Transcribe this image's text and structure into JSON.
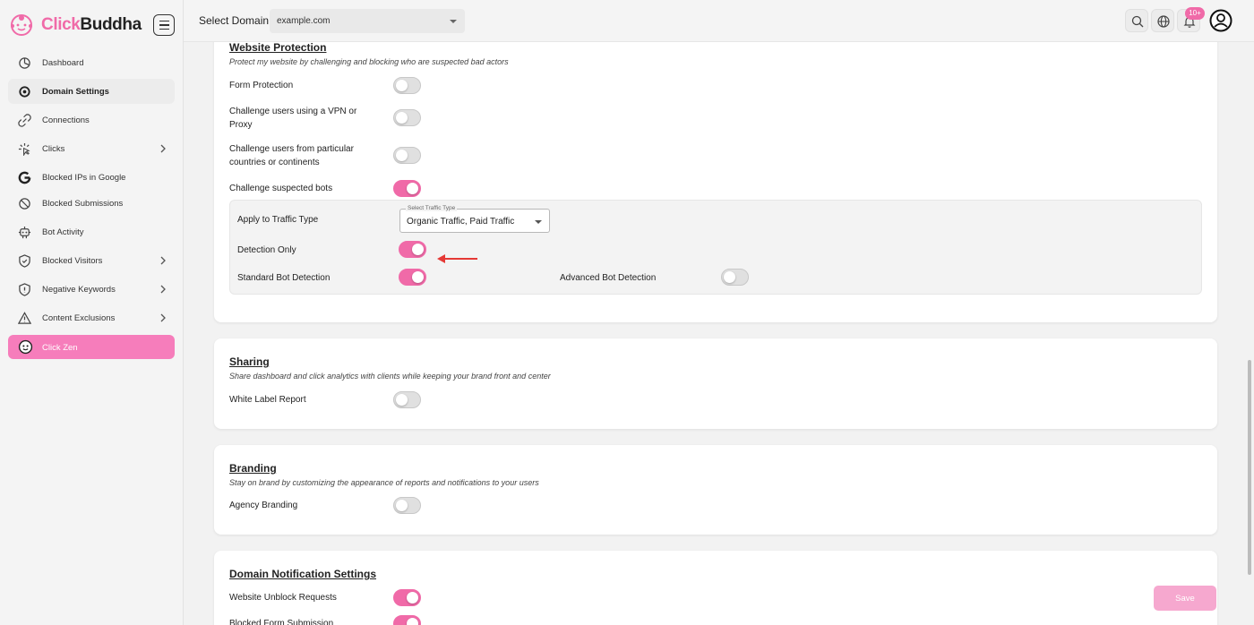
{
  "brand": {
    "name_part1": "Click",
    "name_part2": "Buddha",
    "accent": "#f06aa8"
  },
  "sidebar": {
    "items": [
      {
        "label": "Dashboard",
        "icon": "dashboard-icon"
      },
      {
        "label": "Domain Settings",
        "icon": "settings-icon",
        "active": true
      },
      {
        "label": "Connections",
        "icon": "link-icon"
      },
      {
        "label": "Clicks",
        "icon": "click-icon",
        "has_chevron": true
      },
      {
        "label": "Blocked IPs in Google",
        "icon": "google-icon"
      },
      {
        "label": "Blocked Submissions",
        "icon": "block-icon"
      },
      {
        "label": "Bot Activity",
        "icon": "bot-icon"
      },
      {
        "label": "Blocked Visitors",
        "icon": "shield-icon",
        "has_chevron": true
      },
      {
        "label": "Negative Keywords",
        "icon": "shield-outline-icon",
        "has_chevron": true
      },
      {
        "label": "Content Exclusions",
        "icon": "warning-icon",
        "has_chevron": true
      },
      {
        "label": "Click Zen",
        "icon": "zen-icon",
        "highlighted": true
      }
    ]
  },
  "header": {
    "select_label": "Select Domain",
    "domain_value": "example.com",
    "notification_badge": "10+"
  },
  "website_protection": {
    "title": "Website Protection",
    "description": "Protect my website by challenging and blocking who are suspected bad actors",
    "rows": [
      {
        "label": "Form Protection",
        "on": false
      },
      {
        "label": "Challenge users using a VPN or Proxy",
        "on": false
      },
      {
        "label": "Challenge users from particular countries or continents",
        "on": false
      },
      {
        "label": "Challenge suspected bots",
        "on": true
      }
    ],
    "bots_panel": {
      "traffic_label": "Apply to Traffic Type",
      "traffic_select_legend": "Select Traffic Type",
      "traffic_select_value": "Organic Traffic, Paid Traffic",
      "detection_only_label": "Detection Only",
      "detection_only_on": true,
      "standard_label": "Standard Bot Detection",
      "standard_on": true,
      "advanced_label": "Advanced Bot Detection",
      "advanced_on": false
    }
  },
  "sharing": {
    "title": "Sharing",
    "description": "Share dashboard and click analytics with clients while keeping your brand front and center",
    "rows": [
      {
        "label": "White Label Report",
        "on": false
      }
    ]
  },
  "branding": {
    "title": "Branding",
    "description": "Stay on brand by customizing the appearance of reports and notifications to your users",
    "rows": [
      {
        "label": "Agency Branding",
        "on": false
      }
    ]
  },
  "notifications": {
    "title": "Domain Notification Settings",
    "rows": [
      {
        "label": "Website Unblock Requests",
        "on": true
      },
      {
        "label": "Blocked Form Submission",
        "on": true
      }
    ]
  },
  "save_label": "Save"
}
